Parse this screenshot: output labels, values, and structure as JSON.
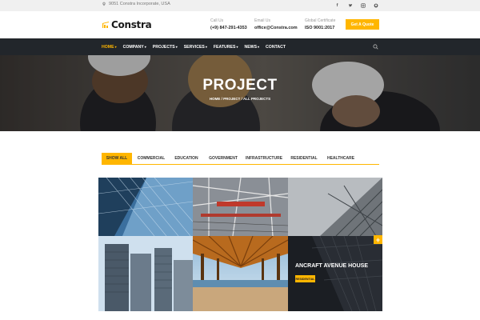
{
  "topbar": {
    "address": "9051 Constra Incorporate, USA",
    "social_icons": [
      "facebook-icon",
      "twitter-icon",
      "instagram-icon",
      "github-icon"
    ]
  },
  "header": {
    "brand": "Constra",
    "call_label": "Call Us",
    "call_value": "(+9) 847-291-4353",
    "email_label": "Email Us",
    "email_value": "office@Constra.com",
    "cert_label": "Global Certificate",
    "cert_value": "ISO 9001:2017",
    "quote_button": "Get A Quote"
  },
  "nav": {
    "items": [
      {
        "label": "HOME",
        "caret": "▾"
      },
      {
        "label": "COMPANY",
        "caret": "▾"
      },
      {
        "label": "PROJECTS",
        "caret": "▾"
      },
      {
        "label": "SERVICES",
        "caret": "▾"
      },
      {
        "label": "FEATURES",
        "caret": "▾"
      },
      {
        "label": "NEWS",
        "caret": "▾"
      },
      {
        "label": "CONTACT",
        "caret": ""
      }
    ]
  },
  "banner": {
    "title": "PROJECT",
    "breadcrumb": "HOME  /  PROJECT  /  ALL PROJECTS"
  },
  "filters": {
    "tabs": [
      "SHOW ALL",
      "COMMERCIAL",
      "EDUCATION",
      "GOVERNMENT",
      "INFRASTRUCTURE",
      "RESIDENTIAL",
      "HEALTHCARE"
    ],
    "active": "SHOW ALL"
  },
  "gallery": {
    "featured_title": "ANCRAFT AVENUE HOUSE",
    "featured_category": "RESIDENTIAL",
    "plus_label": "+"
  },
  "colors": {
    "accent": "#ffb600",
    "nav_bg": "#22262b",
    "topbar_bg": "#f0f0f0"
  }
}
